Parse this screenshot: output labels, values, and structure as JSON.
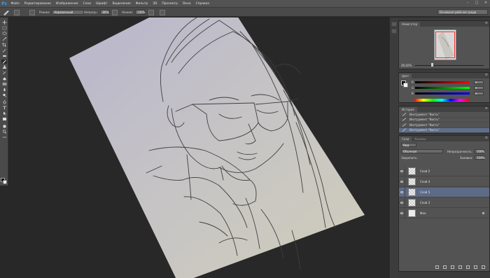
{
  "app": {
    "logo": "Ps"
  },
  "menu": [
    "Файл",
    "Редактирование",
    "Изображение",
    "Слои",
    "Шрифт",
    "Выделение",
    "Фильтр",
    "3D",
    "Просмотр",
    "Окно",
    "Справка"
  ],
  "window_controls": [
    "–",
    "□",
    "✕"
  ],
  "options": {
    "mode_label": "Режим:",
    "mode_value": "Нормальный",
    "opacity_label": "Непрозр.:",
    "opacity_value": "80%",
    "flow_label": "Нажим:",
    "flow_value": "100%",
    "workspace": "Основная рабочая среда"
  },
  "navigator": {
    "tab": "Навигатор",
    "zoom": "26,02%"
  },
  "color": {
    "tab": "Цвет",
    "channels": [
      {
        "label": "R",
        "value": "0"
      },
      {
        "label": "G",
        "value": "0"
      },
      {
        "label": "B",
        "value": "0"
      }
    ]
  },
  "history": {
    "tab": "История",
    "items": [
      "Инструмент \"Кисть\"",
      "Инструмент \"Кисть\"",
      "Инструмент \"Кисть\"",
      "Инструмент \"Кисть\""
    ],
    "active_index": 3
  },
  "layers": {
    "tabs": [
      "Слои",
      "Каналы"
    ],
    "kind": "Вид",
    "blend_mode": "Обычные",
    "opacity_label": "Непрозрачность:",
    "opacity_value": "100%",
    "lock_label": "Закрепить:",
    "fill_label": "Заливка:",
    "fill_value": "100%",
    "items": [
      {
        "name": "Слой 2",
        "selected": false,
        "background": false
      },
      {
        "name": "Слой 4",
        "selected": false,
        "background": false
      },
      {
        "name": "Слой 5",
        "selected": true,
        "background": false
      },
      {
        "name": "Слой 3",
        "selected": false,
        "background": false
      },
      {
        "name": "Фон",
        "selected": false,
        "background": true
      }
    ]
  },
  "colors": {
    "accent": "#5d6b86",
    "panel": "#535353",
    "canvas": "#282828"
  }
}
